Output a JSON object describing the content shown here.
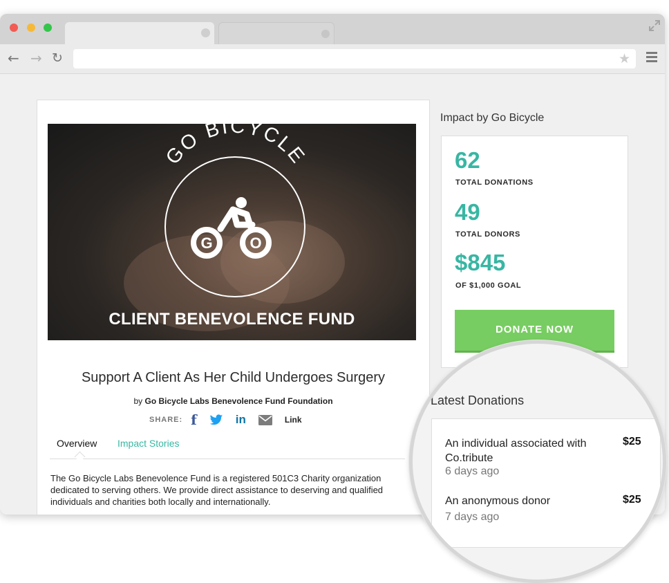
{
  "campaign": {
    "hero_fund_name": "CLIENT BENEVOLENCE FUND",
    "hero_logo_text": "GO BICYCLE",
    "hero_logo_letter_left": "G",
    "hero_logo_letter_right": "O",
    "title": "Support A Client As Her Child Undergoes Surgery",
    "by_prefix": "by",
    "organization": "Go Bicycle Labs Benevolence Fund Foundation",
    "share_label": "SHARE:",
    "share_icons": [
      "facebook-icon",
      "twitter-icon",
      "linkedin-icon",
      "email-icon"
    ],
    "share_link_label": "Link",
    "tabs": [
      {
        "label": "Overview",
        "active": true
      },
      {
        "label": "Impact Stories",
        "active": false
      }
    ],
    "description": "The Go Bicycle Labs Benevolence Fund is a registered 501C3 Charity organization dedicated to serving others. We provide direct assistance to deserving and qualified individuals and charities both locally and internationally."
  },
  "impact": {
    "heading": "Impact by Go Bicycle",
    "stats": [
      {
        "value": "62",
        "label": "TOTAL DONATIONS"
      },
      {
        "value": "49",
        "label": "TOTAL DONORS"
      },
      {
        "value": "$845",
        "label": "OF $1,000 GOAL"
      }
    ],
    "donate_label": "DONATE NOW"
  },
  "latest_donations": {
    "heading": "Latest Donations",
    "items": [
      {
        "name": "An individual associated with Co.tribute",
        "time": "6 days ago",
        "amount": "$25"
      },
      {
        "name": "An anonymous donor",
        "time": "7 days ago",
        "amount": "$25"
      }
    ]
  },
  "colors": {
    "accent_teal": "#38b6a3",
    "donate_green": "#77cd61",
    "facebook": "#3b5998",
    "twitter": "#1da1f2",
    "linkedin": "#0e76a8"
  }
}
